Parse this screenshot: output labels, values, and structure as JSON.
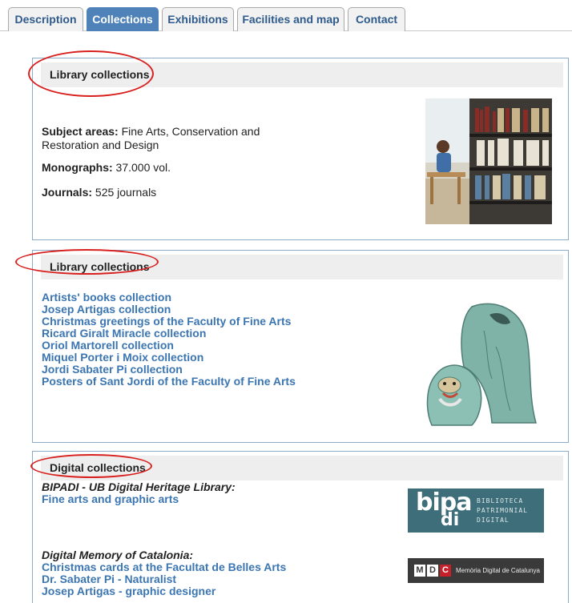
{
  "tabs": [
    {
      "label": "Description",
      "active": false
    },
    {
      "label": "Collections",
      "active": true
    },
    {
      "label": "Exhibitions",
      "active": false
    },
    {
      "label": "Facilities and map",
      "active": false
    },
    {
      "label": "Contact",
      "active": false
    }
  ],
  "library1": {
    "title": "Library collections",
    "subject_label": "Subject areas:",
    "subject_value": " Fine Arts, Conservation and Restoration and Design",
    "monographs_label": "Monographs:",
    "monographs_value": " 37.000 vol.",
    "journals_label": "Journals:",
    "journals_value": " 525 journals"
  },
  "library2": {
    "title": "Library collections",
    "links": [
      "Artists' books collection",
      "Josep Artigas collection",
      "Christmas greetings of the Faculty of Fine Arts",
      "Ricard Giralt Miracle collection",
      "Oriol Martorell collection",
      "Miquel Porter i Moix collection",
      "Jordi Sabater Pi collection",
      "Posters of Sant Jordi of the Faculty of Fine Arts"
    ]
  },
  "digital": {
    "title": "Digital collections",
    "bipadi_label": "BIPADI - UB Digital Heritage Library:",
    "bipadi_link": "Fine arts and graphic arts",
    "mdc_label": "Digital Memory of Catalonia:",
    "mdc_links": [
      "Christmas cards at the Facultat de Belles Arts",
      "Dr. Sabater Pi - Naturalist",
      "Josep Artigas - graphic designer"
    ],
    "bipadi_logo_main": "bipa",
    "bipadi_logo_sub": "di",
    "bipadi_logo_text": [
      "BIBLIOTECA",
      "PATRIMONIAL",
      "DIGITAL"
    ],
    "mdc_logo_letters": [
      "M",
      "D",
      "C"
    ],
    "mdc_logo_text": "Memòria Digital de Catalunya"
  },
  "colors": {
    "accent": "#4e82b8",
    "link": "#3b76b2",
    "annotation": "#d8201e",
    "bipadi_bg": "#3d6e7a",
    "mdc_bg": "#3a3a3a",
    "mdc_red": "#c8202a"
  }
}
